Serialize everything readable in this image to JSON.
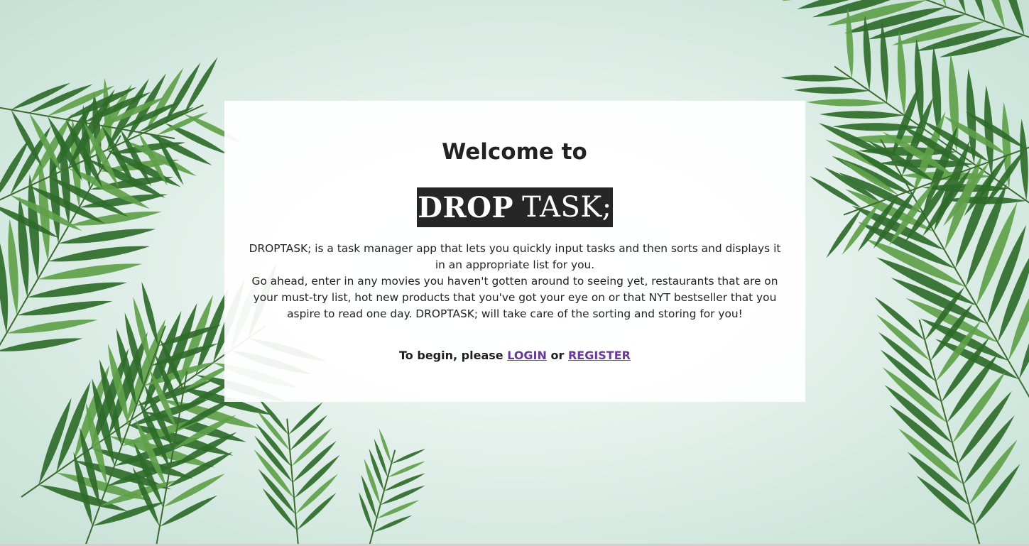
{
  "page": {
    "welcome_title": "Welcome to",
    "logo_bold": "DROP",
    "logo_light": "TASK;",
    "description_line1": "DROPTASK; is a task manager app that lets you quickly input tasks and then sorts and displays it in an appropriate list for you.",
    "description_line2": "Go ahead, enter in any movies you haven't gotten around to seeing yet, restaurants that are on your must-try list, hot new products that you've got your eye on or that NYT bestseller that you aspire to read one day. DROPTASK; will take care of the sorting and storing for you!",
    "cta_prefix": "To begin, please",
    "login_label": "LOGIN",
    "cta_or": "or",
    "register_label": "REGISTER"
  },
  "colors": {
    "link": "#6a3a9a",
    "logo_background": "#262626",
    "leaf_dark": "#2f6b2a",
    "leaf_light": "#5f9f4a",
    "background": "#e4f0eb"
  },
  "background": {
    "decoration": "palm-leaves-illustration"
  }
}
